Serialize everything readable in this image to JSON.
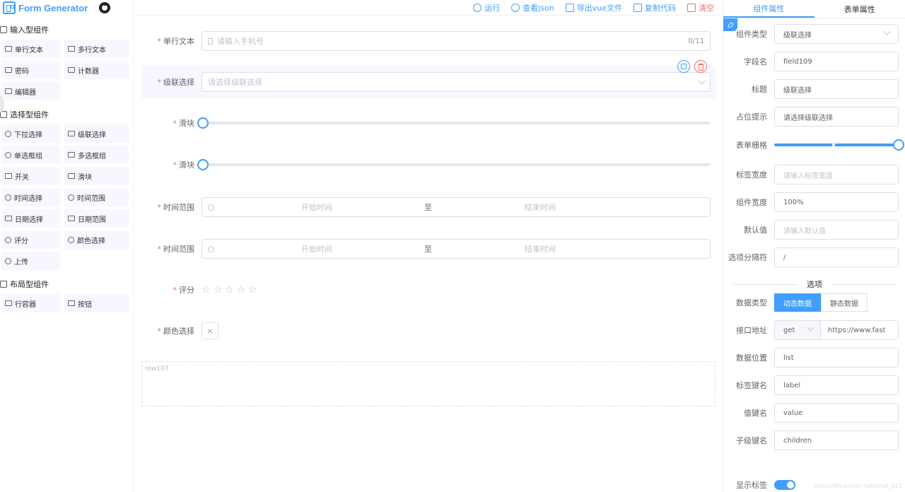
{
  "app": {
    "title": "Form Generator"
  },
  "toolbar": {
    "run": "运行",
    "view_json": "查看json",
    "export_vue": "导出vue文件",
    "copy_code": "复制代码",
    "clear": "清空"
  },
  "left": {
    "groups": [
      {
        "title": "输入型组件",
        "items": [
          {
            "label": "单行文本",
            "icon": "input-icon"
          },
          {
            "label": "多行文本",
            "icon": "textarea-icon"
          },
          {
            "label": "密码",
            "icon": "lock-icon"
          },
          {
            "label": "计数器",
            "icon": "counter-icon"
          },
          {
            "label": "编辑器",
            "icon": "editor-icon"
          }
        ]
      },
      {
        "title": "选择型组件",
        "items": [
          {
            "label": "下拉选择",
            "icon": "select-icon"
          },
          {
            "label": "级联选择",
            "icon": "cascader-icon"
          },
          {
            "label": "单选框组",
            "icon": "radio-icon"
          },
          {
            "label": "多选框组",
            "icon": "checkbox-icon"
          },
          {
            "label": "开关",
            "icon": "switch-icon"
          },
          {
            "label": "滑块",
            "icon": "slider-icon"
          },
          {
            "label": "时间选择",
            "icon": "time-icon"
          },
          {
            "label": "时间范围",
            "icon": "time-range-icon"
          },
          {
            "label": "日期选择",
            "icon": "date-icon"
          },
          {
            "label": "日期范围",
            "icon": "date-range-icon"
          },
          {
            "label": "评分",
            "icon": "star-icon"
          },
          {
            "label": "颜色选择",
            "icon": "palette-icon"
          },
          {
            "label": "上传",
            "icon": "upload-icon"
          }
        ]
      },
      {
        "title": "布局型组件",
        "items": [
          {
            "label": "行容器",
            "icon": "row-icon"
          },
          {
            "label": "按钮",
            "icon": "button-icon"
          }
        ]
      }
    ]
  },
  "form": {
    "single_text": {
      "label": "单行文本",
      "placeholder": "请输入手机号",
      "counter": "0/11"
    },
    "cascader": {
      "label": "级联选择",
      "placeholder": "请选择级联选择"
    },
    "slider1": {
      "label": "滑块",
      "value": 0
    },
    "slider2": {
      "label": "滑块",
      "value": 0
    },
    "time_range1": {
      "label": "时间范围",
      "start": "开始时间",
      "sep": "至",
      "end": "结束时间"
    },
    "time_range2": {
      "label": "时间范围",
      "start": "开始时间",
      "sep": "至",
      "end": "结束时间"
    },
    "rate": {
      "label": "评分",
      "stars": [
        "☆",
        "☆",
        "☆",
        "☆",
        "☆"
      ]
    },
    "color": {
      "label": "颜色选择",
      "clear": "×"
    },
    "row": {
      "tag": "row107"
    }
  },
  "right": {
    "tabs": [
      "组件属性",
      "表单属性"
    ],
    "props": [
      {
        "label": "组件类型",
        "value": "级联选择"
      },
      {
        "label": "字段名",
        "value": "field109"
      },
      {
        "label": "标题",
        "value": "级联选择"
      },
      {
        "label": "占位提示",
        "value": "请选择级联选择"
      },
      {
        "label": "表单栅格",
        "slider": 1.0
      },
      {
        "label": "标签宽度",
        "placeholder": "请输入标签宽度"
      },
      {
        "label": "组件宽度",
        "value": "100%"
      },
      {
        "label": "默认值",
        "placeholder": "请输入默认值"
      },
      {
        "label": "选项分隔符",
        "value": "/"
      }
    ],
    "options_divider": "选项",
    "data_type": {
      "label": "数据类型",
      "options": [
        "动态数据",
        "静态数据"
      ],
      "selected": "动态数据"
    },
    "api": {
      "label": "接口地址",
      "method": "get",
      "url": "https://www.fast"
    },
    "data_fields": [
      {
        "label": "数据位置",
        "value": "list"
      },
      {
        "label": "标签键名",
        "value": "label"
      },
      {
        "label": "值键名",
        "value": "value"
      },
      {
        "label": "子级键名",
        "value": "children"
      }
    ],
    "show_label": {
      "label": "显示标签",
      "on": true
    },
    "watermark": "https://blog.csdn.net/sinat_021"
  },
  "colors": {
    "primary": "#409eff",
    "danger": "#f56c6c"
  }
}
